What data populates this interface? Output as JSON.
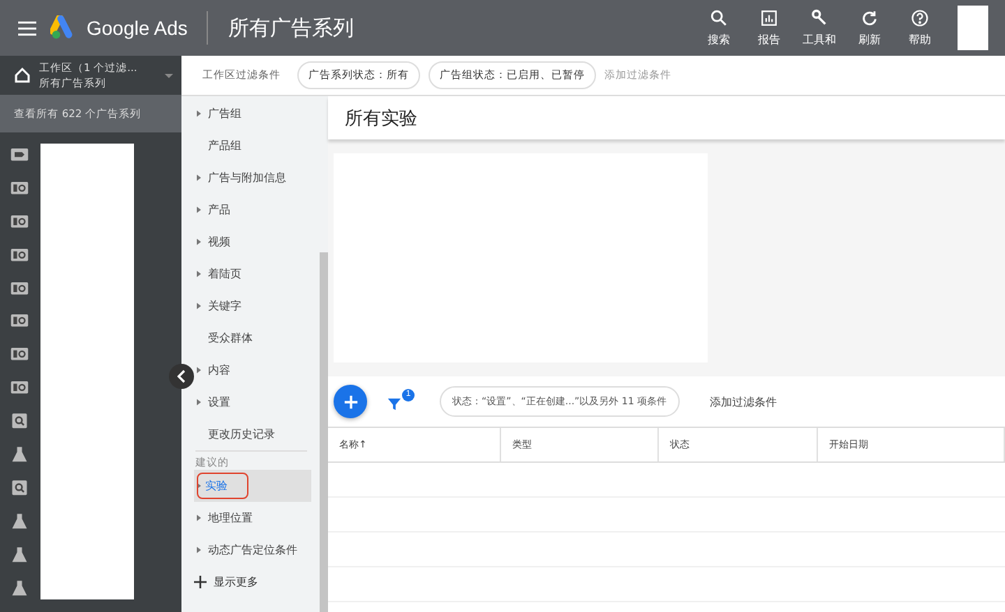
{
  "topbar": {
    "product": "Google Ads",
    "page_title": "所有广告系列",
    "actions": [
      "搜索",
      "报告",
      "工具和",
      "刷新",
      "帮助"
    ]
  },
  "workspace": {
    "line1": "工作区（1 个过滤...",
    "line2": "所有广告系列",
    "view_all": "查看所有 622 个广告系列"
  },
  "rail_icons": [
    {
      "kind": "tag"
    },
    {
      "kind": "card"
    },
    {
      "kind": "card"
    },
    {
      "kind": "card"
    },
    {
      "kind": "card"
    },
    {
      "kind": "card"
    },
    {
      "kind": "card"
    },
    {
      "kind": "card"
    },
    {
      "kind": "search"
    },
    {
      "kind": "flask"
    },
    {
      "kind": "search"
    },
    {
      "kind": "flask"
    },
    {
      "kind": "flask"
    },
    {
      "kind": "flask"
    }
  ],
  "filter_bar": {
    "label": "工作区过滤条件",
    "chips": [
      "广告系列状态：所有",
      "广告组状态：已启用、已暂停"
    ],
    "add": "添加过滤条件"
  },
  "nav": [
    {
      "kind": "item",
      "label": "广告组",
      "expandable": true,
      "selected": false,
      "highlighted": false
    },
    {
      "kind": "item",
      "label": "产品组",
      "expandable": false,
      "selected": false,
      "highlighted": false
    },
    {
      "kind": "item",
      "label": "广告与附加信息",
      "expandable": true,
      "selected": false,
      "highlighted": false
    },
    {
      "kind": "item",
      "label": "产品",
      "expandable": true,
      "selected": false,
      "highlighted": false
    },
    {
      "kind": "item",
      "label": "视频",
      "expandable": true,
      "selected": false,
      "highlighted": false
    },
    {
      "kind": "item",
      "label": "着陆页",
      "expandable": true,
      "selected": false,
      "highlighted": false
    },
    {
      "kind": "item",
      "label": "关键字",
      "expandable": true,
      "selected": false,
      "highlighted": false
    },
    {
      "kind": "item",
      "label": "受众群体",
      "expandable": false,
      "selected": false,
      "highlighted": false
    },
    {
      "kind": "item",
      "label": "内容",
      "expandable": true,
      "selected": false,
      "highlighted": false
    },
    {
      "kind": "item",
      "label": "设置",
      "expandable": true,
      "selected": false,
      "highlighted": false
    },
    {
      "kind": "item",
      "label": "更改历史记录",
      "expandable": false,
      "selected": false,
      "highlighted": false
    },
    {
      "kind": "section",
      "label": "建议的"
    },
    {
      "kind": "item",
      "label": "实验",
      "expandable": true,
      "selected": true,
      "highlighted": true
    },
    {
      "kind": "item",
      "label": "地理位置",
      "expandable": true,
      "selected": false,
      "highlighted": false
    },
    {
      "kind": "item",
      "label": "动态广告定位条件",
      "expandable": true,
      "selected": false,
      "highlighted": false
    },
    {
      "kind": "more",
      "label": "显示更多"
    }
  ],
  "main": {
    "title": "所有实验",
    "filter_count": "1",
    "status_chip": "状态：“设置”、“正在创建...”以及另外 11 项条件",
    "add_filter": "添加过滤条件",
    "table": {
      "columns": [
        {
          "label": "名称",
          "sort": "↑"
        },
        {
          "label": "类型"
        },
        {
          "label": "状态"
        },
        {
          "label": "开始日期"
        }
      ]
    }
  }
}
